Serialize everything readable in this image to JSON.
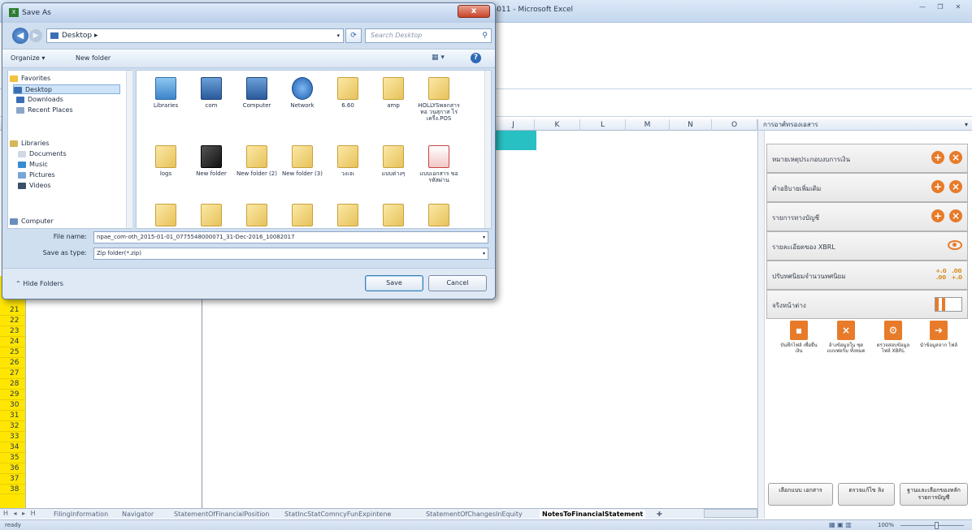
{
  "excel": {
    "title": "-011 - Microsoft Excel",
    "column_headers": [
      "J",
      "K",
      "L",
      "M",
      "N",
      "O"
    ],
    "row_numbers": [
      "21",
      "22",
      "23",
      "24",
      "25",
      "26",
      "27",
      "28",
      "29",
      "30",
      "31",
      "32",
      "33",
      "34",
      "35",
      "36",
      "37",
      "38"
    ],
    "sheet_tabs": [
      "FilingInformation",
      "Navigator",
      "StatementOfFinancialPosition",
      "StatIncStatComncyFunExpintene",
      "StatementOfChangesInEquity",
      "NotesToFinancialStatement"
    ],
    "active_tab": "NotesToFinancialStatement",
    "tab_nav": "H ◂ ▸ H",
    "status_ready": "ready",
    "zoom": "100%"
  },
  "task_pane": {
    "header": "การอาศ์ทรองเอสาร",
    "rows": [
      {
        "label": "หมายเหตุประกอบงบการเงิน"
      },
      {
        "label": "คำอธิบายเพิ่มเติม"
      },
      {
        "label": "รายการทางบัญชี"
      },
      {
        "label": "รายละเอียดของ XBRL"
      },
      {
        "label": "ปรับทศนิยมจำนวนทศนิยม"
      },
      {
        "label": "จริงหน้าต่าง"
      }
    ],
    "actions": [
      {
        "label": "บันทึกไฟล์ เพื่อยื่นเงิน"
      },
      {
        "label": "ล้างข้อมูลใน ชุดแบบฟอร์ม ทั้งหมด"
      },
      {
        "label": "ตรวจสอบข้อมูล ไฟล์ XBRL"
      },
      {
        "label": "นำข้อมูลจาก ไฟล์"
      }
    ],
    "bottom_buttons": [
      "เลือกแบบ เอกสาร",
      "ตรวจแก้ไข ลิง",
      "ฐานและเลือกของหลัก รายการบัญชี"
    ]
  },
  "dialog": {
    "title": "Save As",
    "close_glyph": "x",
    "address_path": "Desktop ▸",
    "search_placeholder": "Search Desktop",
    "toolbar": {
      "organize": "Organize ▾",
      "new_folder": "New folder"
    },
    "nav_items": [
      {
        "label": "Favorites",
        "color": "#f3c041"
      },
      {
        "label": "Desktop",
        "color": "#3b6fb5"
      },
      {
        "label": "Downloads",
        "color": "#3b6fb5"
      },
      {
        "label": "Recent Places",
        "color": "#8aa6c8"
      },
      {
        "label": "Libraries",
        "color": "#d6b75a"
      },
      {
        "label": "Documents",
        "color": "#d0d8e4"
      },
      {
        "label": "Music",
        "color": "#3a8ad1"
      },
      {
        "label": "Pictures",
        "color": "#77a6d6"
      },
      {
        "label": "Videos",
        "color": "#3c4f6b"
      },
      {
        "label": "Computer",
        "color": "#6b8fbd"
      }
    ],
    "files_row1": [
      "Libraries",
      "com",
      "Computer",
      "Network",
      "6.60",
      "amp",
      "HOLLYSพลกสารหอ วนสุกาส ไร่ เครื่ง.POS"
    ],
    "files_row2": [
      "logs",
      "New folder",
      "New folder (2)",
      "New folder (3)",
      "วงเจเ",
      "แบบต่างๆ",
      "แบบเอกสาร ขอรหัสผ่าน"
    ],
    "file_name_label": "File name:",
    "file_name_value": "npae_com-oth_2015-01-01_0775548000071_31-Dec-2016_10082017",
    "save_type_label": "Save as type:",
    "save_type_value": "Zip folder(*.zip)",
    "hide_folders": "Hide Folders",
    "save_label": "Save",
    "cancel_label": "Cancel"
  }
}
